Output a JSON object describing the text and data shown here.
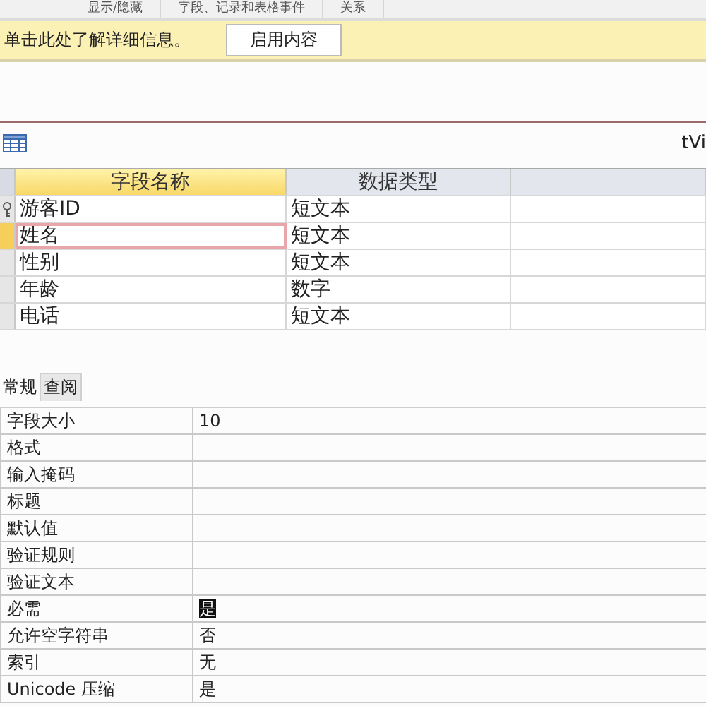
{
  "ribbon_groups": [
    "显示/隐藏",
    "字段、记录和表格事件",
    "关系"
  ],
  "message_bar": {
    "text": "单击此处了解详细信息。",
    "button": "启用内容"
  },
  "document_tab": {
    "title": "tVi"
  },
  "design_grid": {
    "columns": [
      "字段名称",
      "数据类型"
    ],
    "rows": [
      {
        "name": "游客ID",
        "type": "短文本",
        "primary_key": true,
        "selected": false
      },
      {
        "name": "姓名",
        "type": "短文本",
        "selected": true
      },
      {
        "name": "性别",
        "type": "短文本",
        "selected": false
      },
      {
        "name": "年龄",
        "type": "数字",
        "selected": false
      },
      {
        "name": "电话",
        "type": "短文本",
        "selected": false
      }
    ]
  },
  "property_tabs": [
    {
      "label": "常规",
      "selected": true
    },
    {
      "label": "查阅",
      "selected": false
    }
  ],
  "properties": [
    {
      "label": "字段大小",
      "value": "10"
    },
    {
      "label": "格式"
    },
    {
      "label": "输入掩码"
    },
    {
      "label": "标题"
    },
    {
      "label": "默认值"
    },
    {
      "label": "验证规则"
    },
    {
      "label": "验证文本"
    },
    {
      "label": "必需",
      "value": "是",
      "highlighted": true
    },
    {
      "label": "允许空字符串",
      "value": "否"
    },
    {
      "label": "索引",
      "value": "无"
    },
    {
      "label": "Unicode 压缩",
      "value": "是"
    }
  ]
}
